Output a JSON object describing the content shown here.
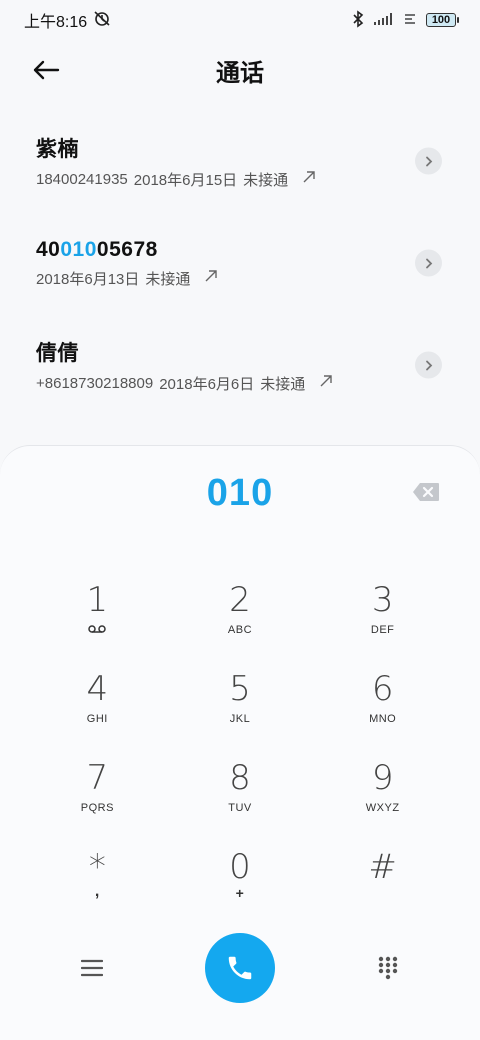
{
  "status_bar": {
    "time": "上午8:16",
    "battery": "100"
  },
  "header": {
    "title": "通话"
  },
  "calls": [
    {
      "name": "紫楠",
      "name_parts": [
        "紫楠",
        "",
        ""
      ],
      "number": "18400241935",
      "date": "2018年6月15日",
      "status": "未接通"
    },
    {
      "name": "4001005678",
      "name_parts": [
        "40",
        "010",
        "05678"
      ],
      "number": "",
      "date": "2018年6月13日",
      "status": "未接通"
    },
    {
      "name": "倩倩",
      "name_parts": [
        "倩倩",
        "",
        ""
      ],
      "number": "+8618730218809",
      "date": "2018年6月6日",
      "status": "未接通"
    }
  ],
  "dialpad": {
    "input": "010",
    "keys": [
      {
        "num": "1",
        "sub": "voicemail"
      },
      {
        "num": "2",
        "sub": "ABC"
      },
      {
        "num": "3",
        "sub": "DEF"
      },
      {
        "num": "4",
        "sub": "GHI"
      },
      {
        "num": "5",
        "sub": "JKL"
      },
      {
        "num": "6",
        "sub": "MNO"
      },
      {
        "num": "7",
        "sub": "PQRS"
      },
      {
        "num": "8",
        "sub": "TUV"
      },
      {
        "num": "9",
        "sub": "WXYZ"
      },
      {
        "num": "*",
        "sub": ","
      },
      {
        "num": "0",
        "sub": "+"
      },
      {
        "num": "#",
        "sub": ""
      }
    ]
  },
  "colors": {
    "accent": "#1aa3e8",
    "call_button": "#14a8ef"
  }
}
